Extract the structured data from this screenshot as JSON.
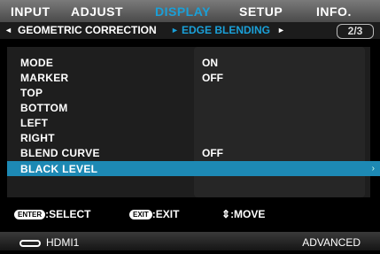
{
  "tabs": [
    {
      "label": "INPUT"
    },
    {
      "label": "ADJUST"
    },
    {
      "label": "DISPLAY"
    },
    {
      "label": "SETUP"
    },
    {
      "label": "INFO."
    }
  ],
  "breadcrumb": {
    "left_arrow": "◄",
    "parent": "GEOMETRIC CORRECTION",
    "separator": "►",
    "current": "EDGE BLENDING",
    "right_arrow": "►",
    "page": "2/3"
  },
  "menu": {
    "rows": [
      {
        "label": "MODE",
        "value": "ON"
      },
      {
        "label": "MARKER",
        "value": "OFF"
      },
      {
        "label": "TOP",
        "value": ""
      },
      {
        "label": "BOTTOM",
        "value": ""
      },
      {
        "label": "LEFT",
        "value": ""
      },
      {
        "label": "RIGHT",
        "value": ""
      },
      {
        "label": "BLEND CURVE",
        "value": "OFF"
      },
      {
        "label": "BLACK LEVEL",
        "value": "",
        "selected": true,
        "caret": "›"
      }
    ]
  },
  "hints": {
    "enter_key": "ENTER",
    "enter_action": ":SELECT",
    "exit_key": "EXIT",
    "exit_action": ":EXIT",
    "move_symbol": "⇕",
    "move_action": ":MOVE"
  },
  "status": {
    "input_icon": "hdmi-input-icon",
    "input": "HDMI1",
    "mode": "ADVANCED"
  },
  "colors": {
    "active_tab": "#1aa0d8",
    "selected_row": "#1d89b4"
  }
}
